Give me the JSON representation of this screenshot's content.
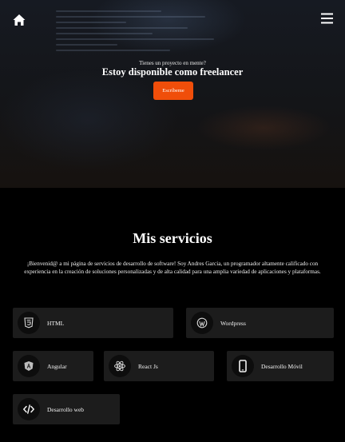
{
  "nav": {
    "home_icon": "home-icon",
    "menu_icon": "menu-icon"
  },
  "hero": {
    "eyebrow": "Tienes un proyecto en mente?",
    "title": "Estoy disponible como freelancer",
    "cta_label": "Escríbeme",
    "cta_color": "#f04e0a"
  },
  "services": {
    "title": "Mis servicios",
    "description": "¡Bienvenid@ a mi página de servicios de desarrollo de software! Soy Andres Garcia, un programador altamente calificado con experiencia en la creación de soluciones personalizadas y de alta calidad para una amplia variedad de aplicaciones y plataformas.",
    "items": [
      {
        "label": "HTML",
        "icon": "html5-icon"
      },
      {
        "label": "Wordpress",
        "icon": "wordpress-icon"
      },
      {
        "label": "Angular",
        "icon": "angular-icon"
      },
      {
        "label": "React Js",
        "icon": "react-icon"
      },
      {
        "label": "Desarrollo Móvil",
        "icon": "mobile-phone-icon"
      },
      {
        "label": "Desarrollo web",
        "icon": "code-icon"
      }
    ]
  }
}
